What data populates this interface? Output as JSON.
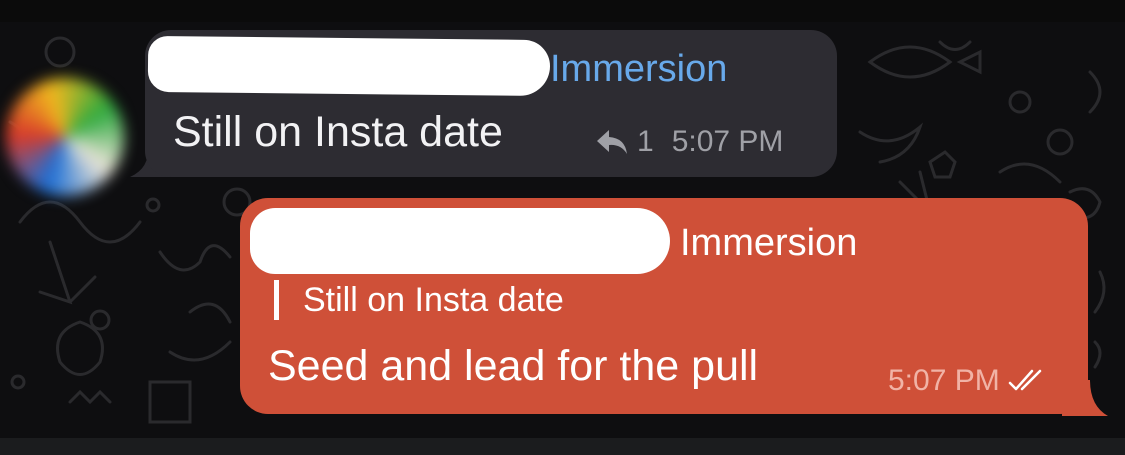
{
  "messages": [
    {
      "direction": "incoming",
      "sender": "Immersion",
      "text": "Still on Insta date",
      "reply_count": "1",
      "time": "5:07 PM",
      "reply_icon": "reply-arrow-icon"
    },
    {
      "direction": "outgoing",
      "sender": "Immersion",
      "quoted_text": "Still on Insta date",
      "text": "Seed and lead for the pull",
      "time": "5:07 PM",
      "status_icon": "double-check-icon"
    }
  ],
  "colors": {
    "incoming_bubble": "#2d2c32",
    "outgoing_bubble": "#cf5038",
    "incoming_sender": "#68a9ea",
    "background": "#0e0e10"
  }
}
